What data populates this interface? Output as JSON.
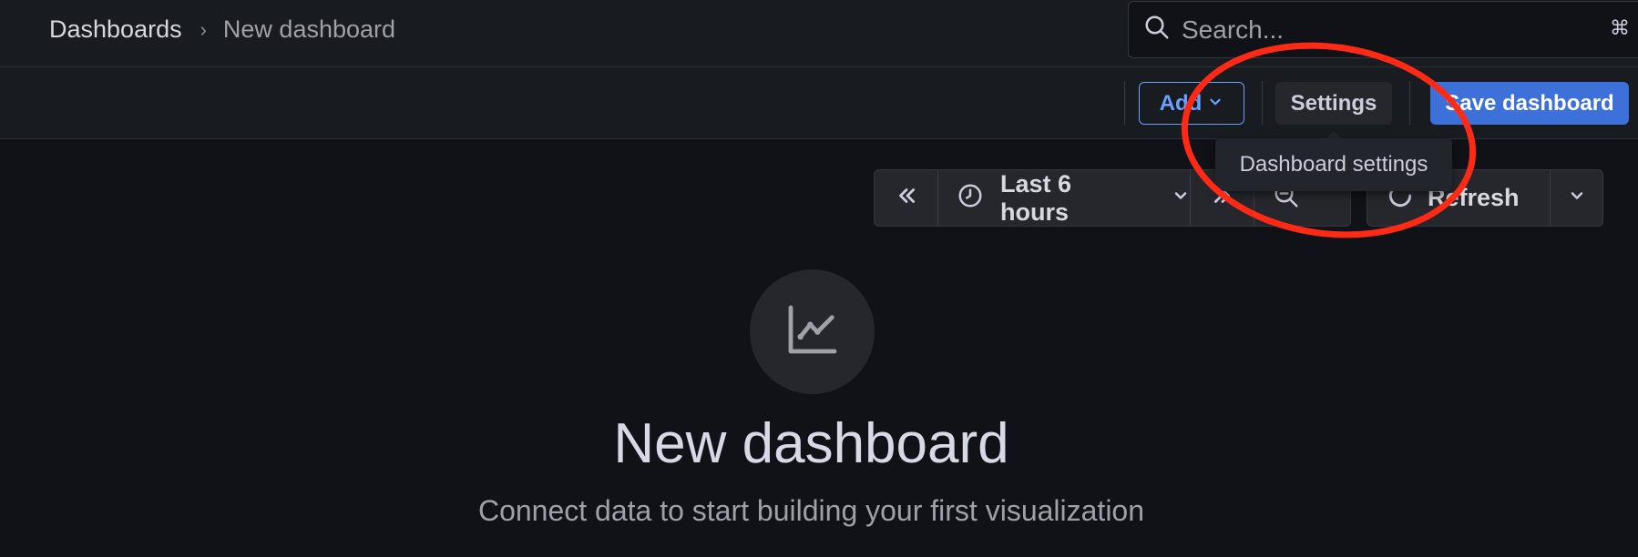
{
  "breadcrumb": {
    "root": "Dashboards",
    "separator": "›",
    "current": "New dashboard"
  },
  "search": {
    "placeholder": "Search...",
    "shortcut": "⌘"
  },
  "toolbar": {
    "add_label": "Add",
    "settings_label": "Settings",
    "save_label": "Save dashboard"
  },
  "tooltip": {
    "text": "Dashboard settings"
  },
  "time_picker": {
    "range_label": "Last 6 hours"
  },
  "refresh": {
    "label": "Refresh"
  },
  "empty_state": {
    "title": "New dashboard",
    "subtitle": "Connect data to start building your first visualization"
  },
  "colors": {
    "background": "#111217",
    "primary": "#3d71d9",
    "annotation": "#ff2a16"
  },
  "icons": [
    "search-icon",
    "chevron-down-icon",
    "chevrons-left-icon",
    "clock-icon",
    "chevrons-right-icon",
    "zoom-out-icon",
    "refresh-icon",
    "chart-line-icon"
  ]
}
